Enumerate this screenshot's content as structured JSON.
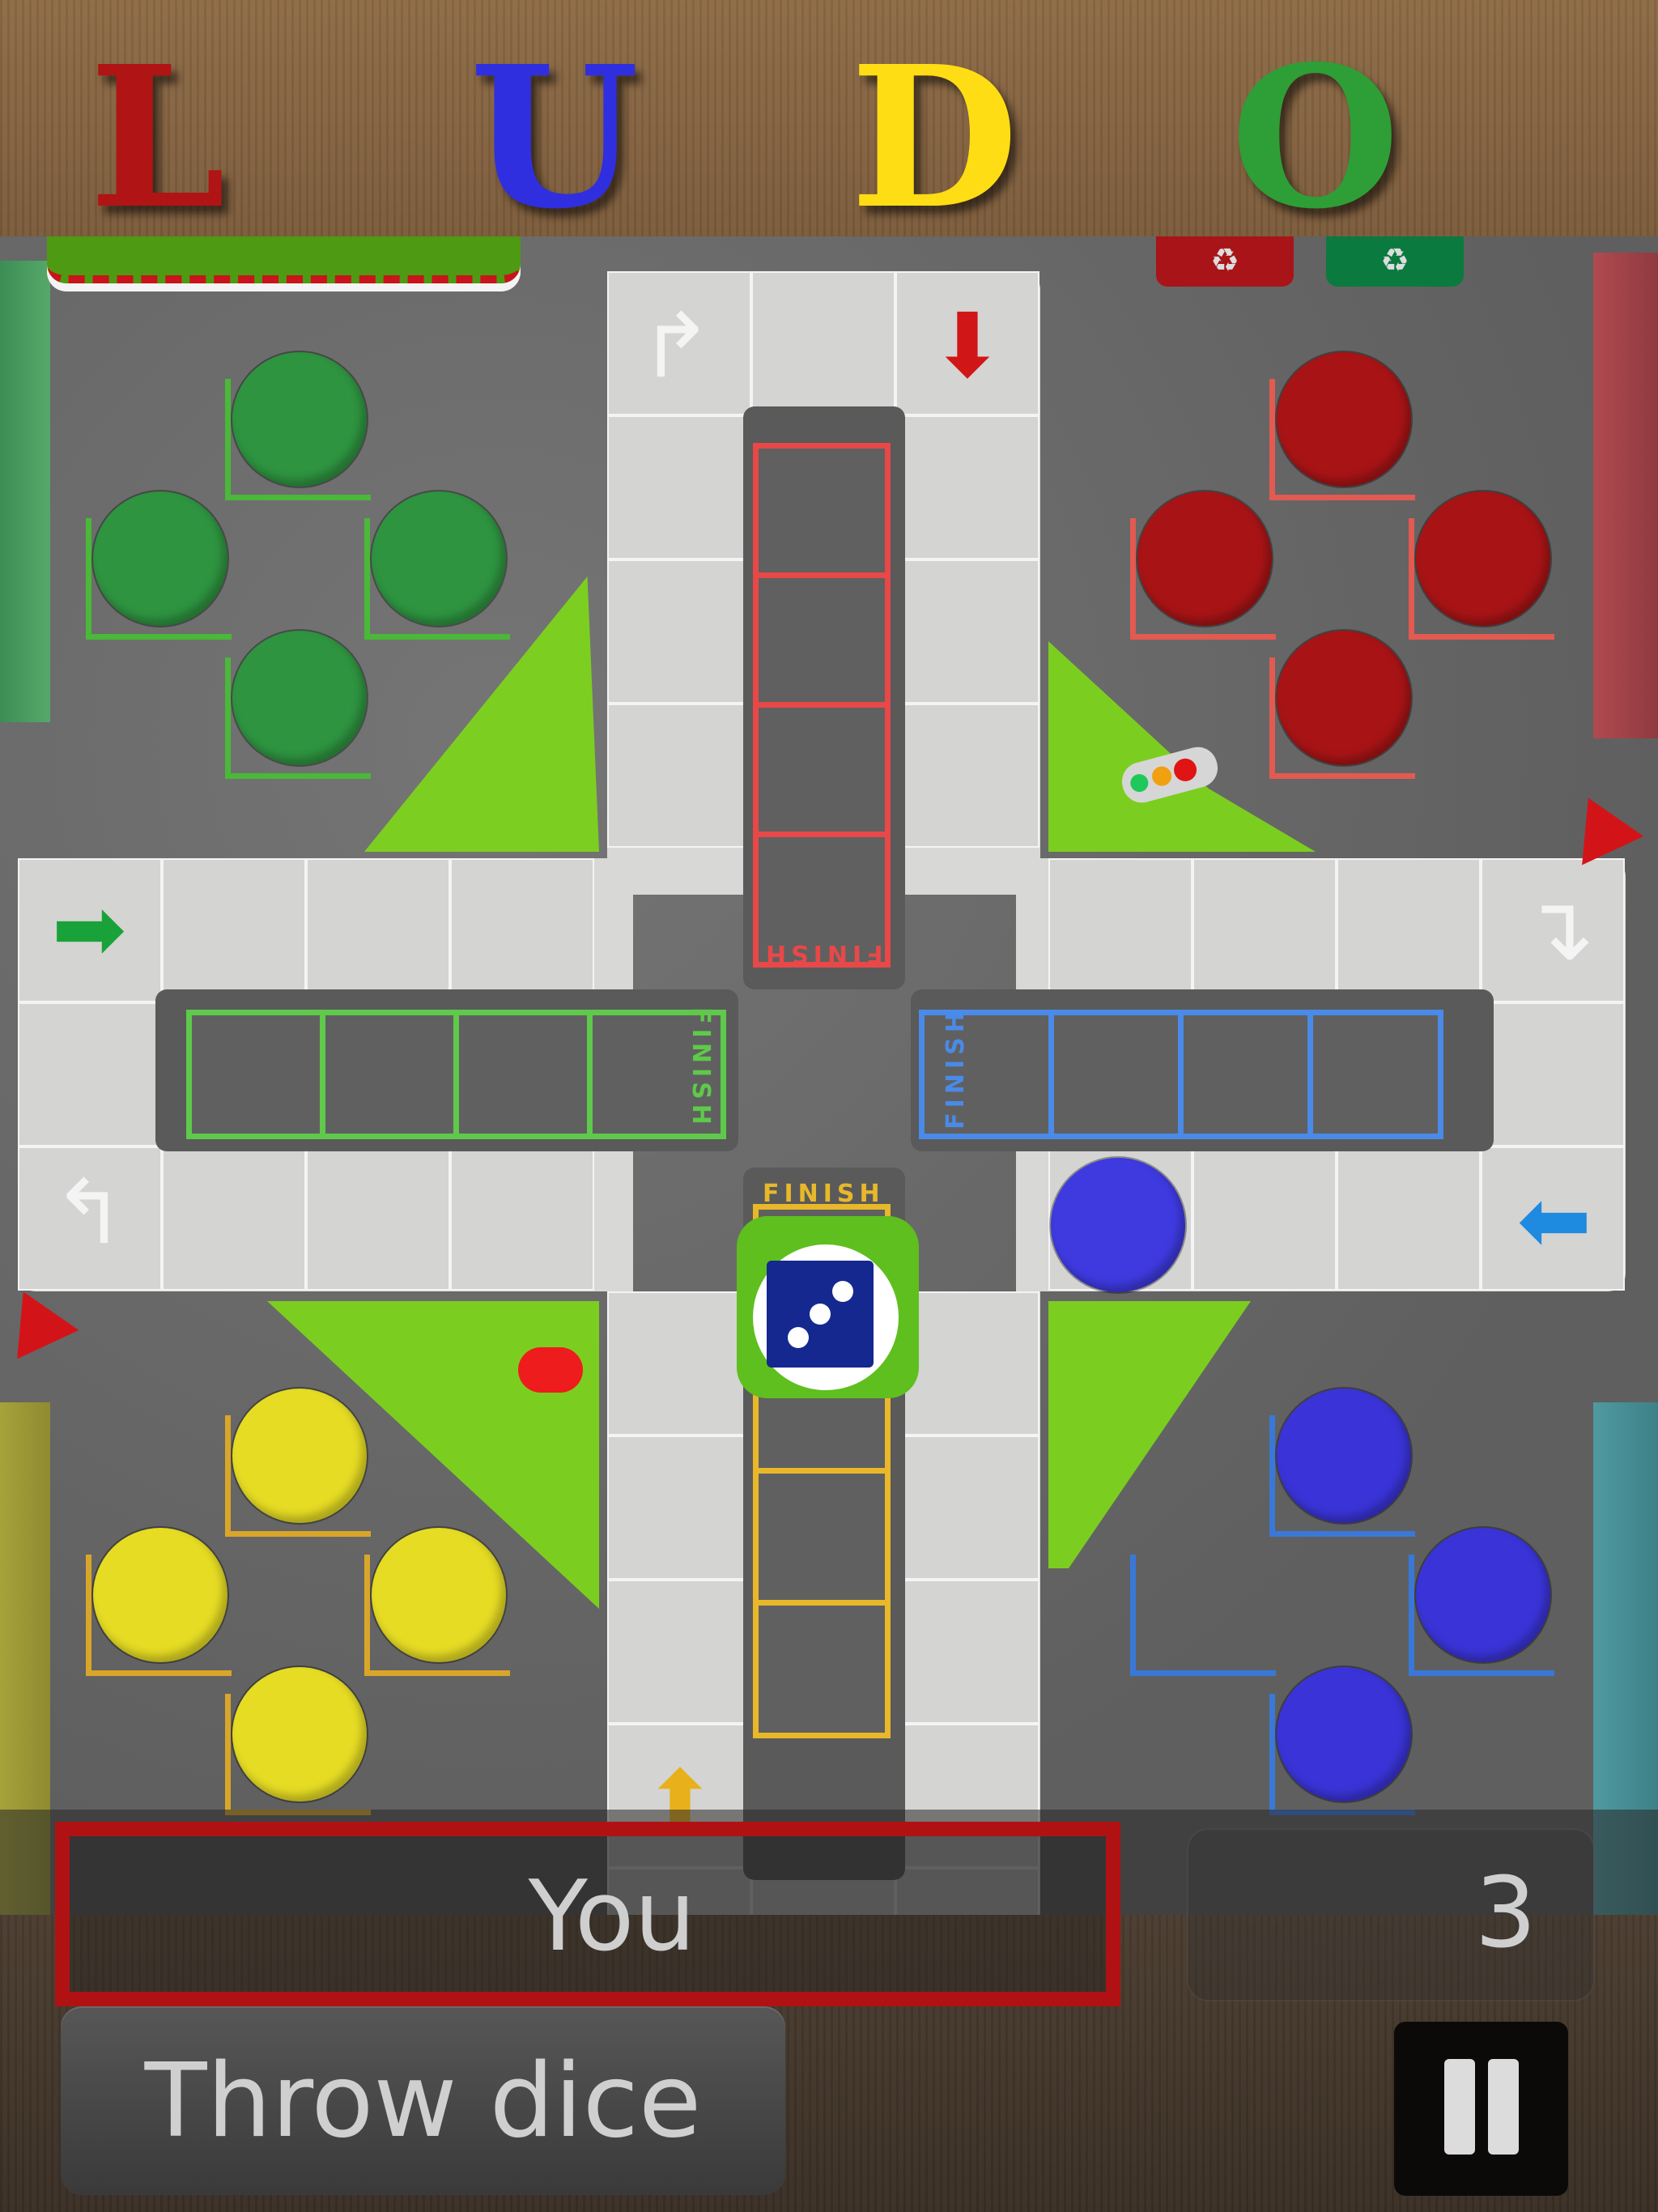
{
  "header": {
    "title_letters": [
      {
        "char": "L",
        "color": "#b01414"
      },
      {
        "char": "U",
        "color": "#2f2fe0"
      },
      {
        "char": "D",
        "color": "#ffdd14"
      },
      {
        "char": "O",
        "color": "#2e9e36"
      }
    ]
  },
  "board": {
    "finish_label": "FINISH",
    "home_columns": [
      {
        "color": "red",
        "hex": "#e84848"
      },
      {
        "color": "green",
        "hex": "#5ec94a"
      },
      {
        "color": "blue",
        "hex": "#4a8ae8"
      },
      {
        "color": "yellow",
        "hex": "#e8b82a"
      }
    ],
    "dice_face": 3,
    "bases": [
      {
        "player": "green",
        "hex": "#2e9440",
        "mark_hex": "#4ab838",
        "tokens_in_base": 4
      },
      {
        "player": "red",
        "hex": "#a81416",
        "mark_hex": "#e25a50",
        "tokens_in_base": 4
      },
      {
        "player": "yellow",
        "hex": "#e6dc24",
        "mark_hex": "#d9a62a",
        "tokens_in_base": 4
      },
      {
        "player": "blue",
        "hex": "#3a34d8",
        "mark_hex": "#3a78d8",
        "tokens_in_base": 3
      }
    ],
    "tokens_on_track": [
      {
        "player": "blue",
        "hex": "#3e3ae0",
        "position": "right arm, bottom row, 6th tile from right edge"
      }
    ],
    "arrows": {
      "green_start": "➡",
      "red_start": "⬇",
      "blue_start": "⬅",
      "yellow_start": "⬆"
    }
  },
  "status": {
    "current_player": "You",
    "current_player_border": "#b01214",
    "dice_value": "3"
  },
  "controls": {
    "throw_label": "Throw dice",
    "pause_icon": "pause-icon"
  },
  "decor": {
    "bin_symbol": "♻"
  }
}
